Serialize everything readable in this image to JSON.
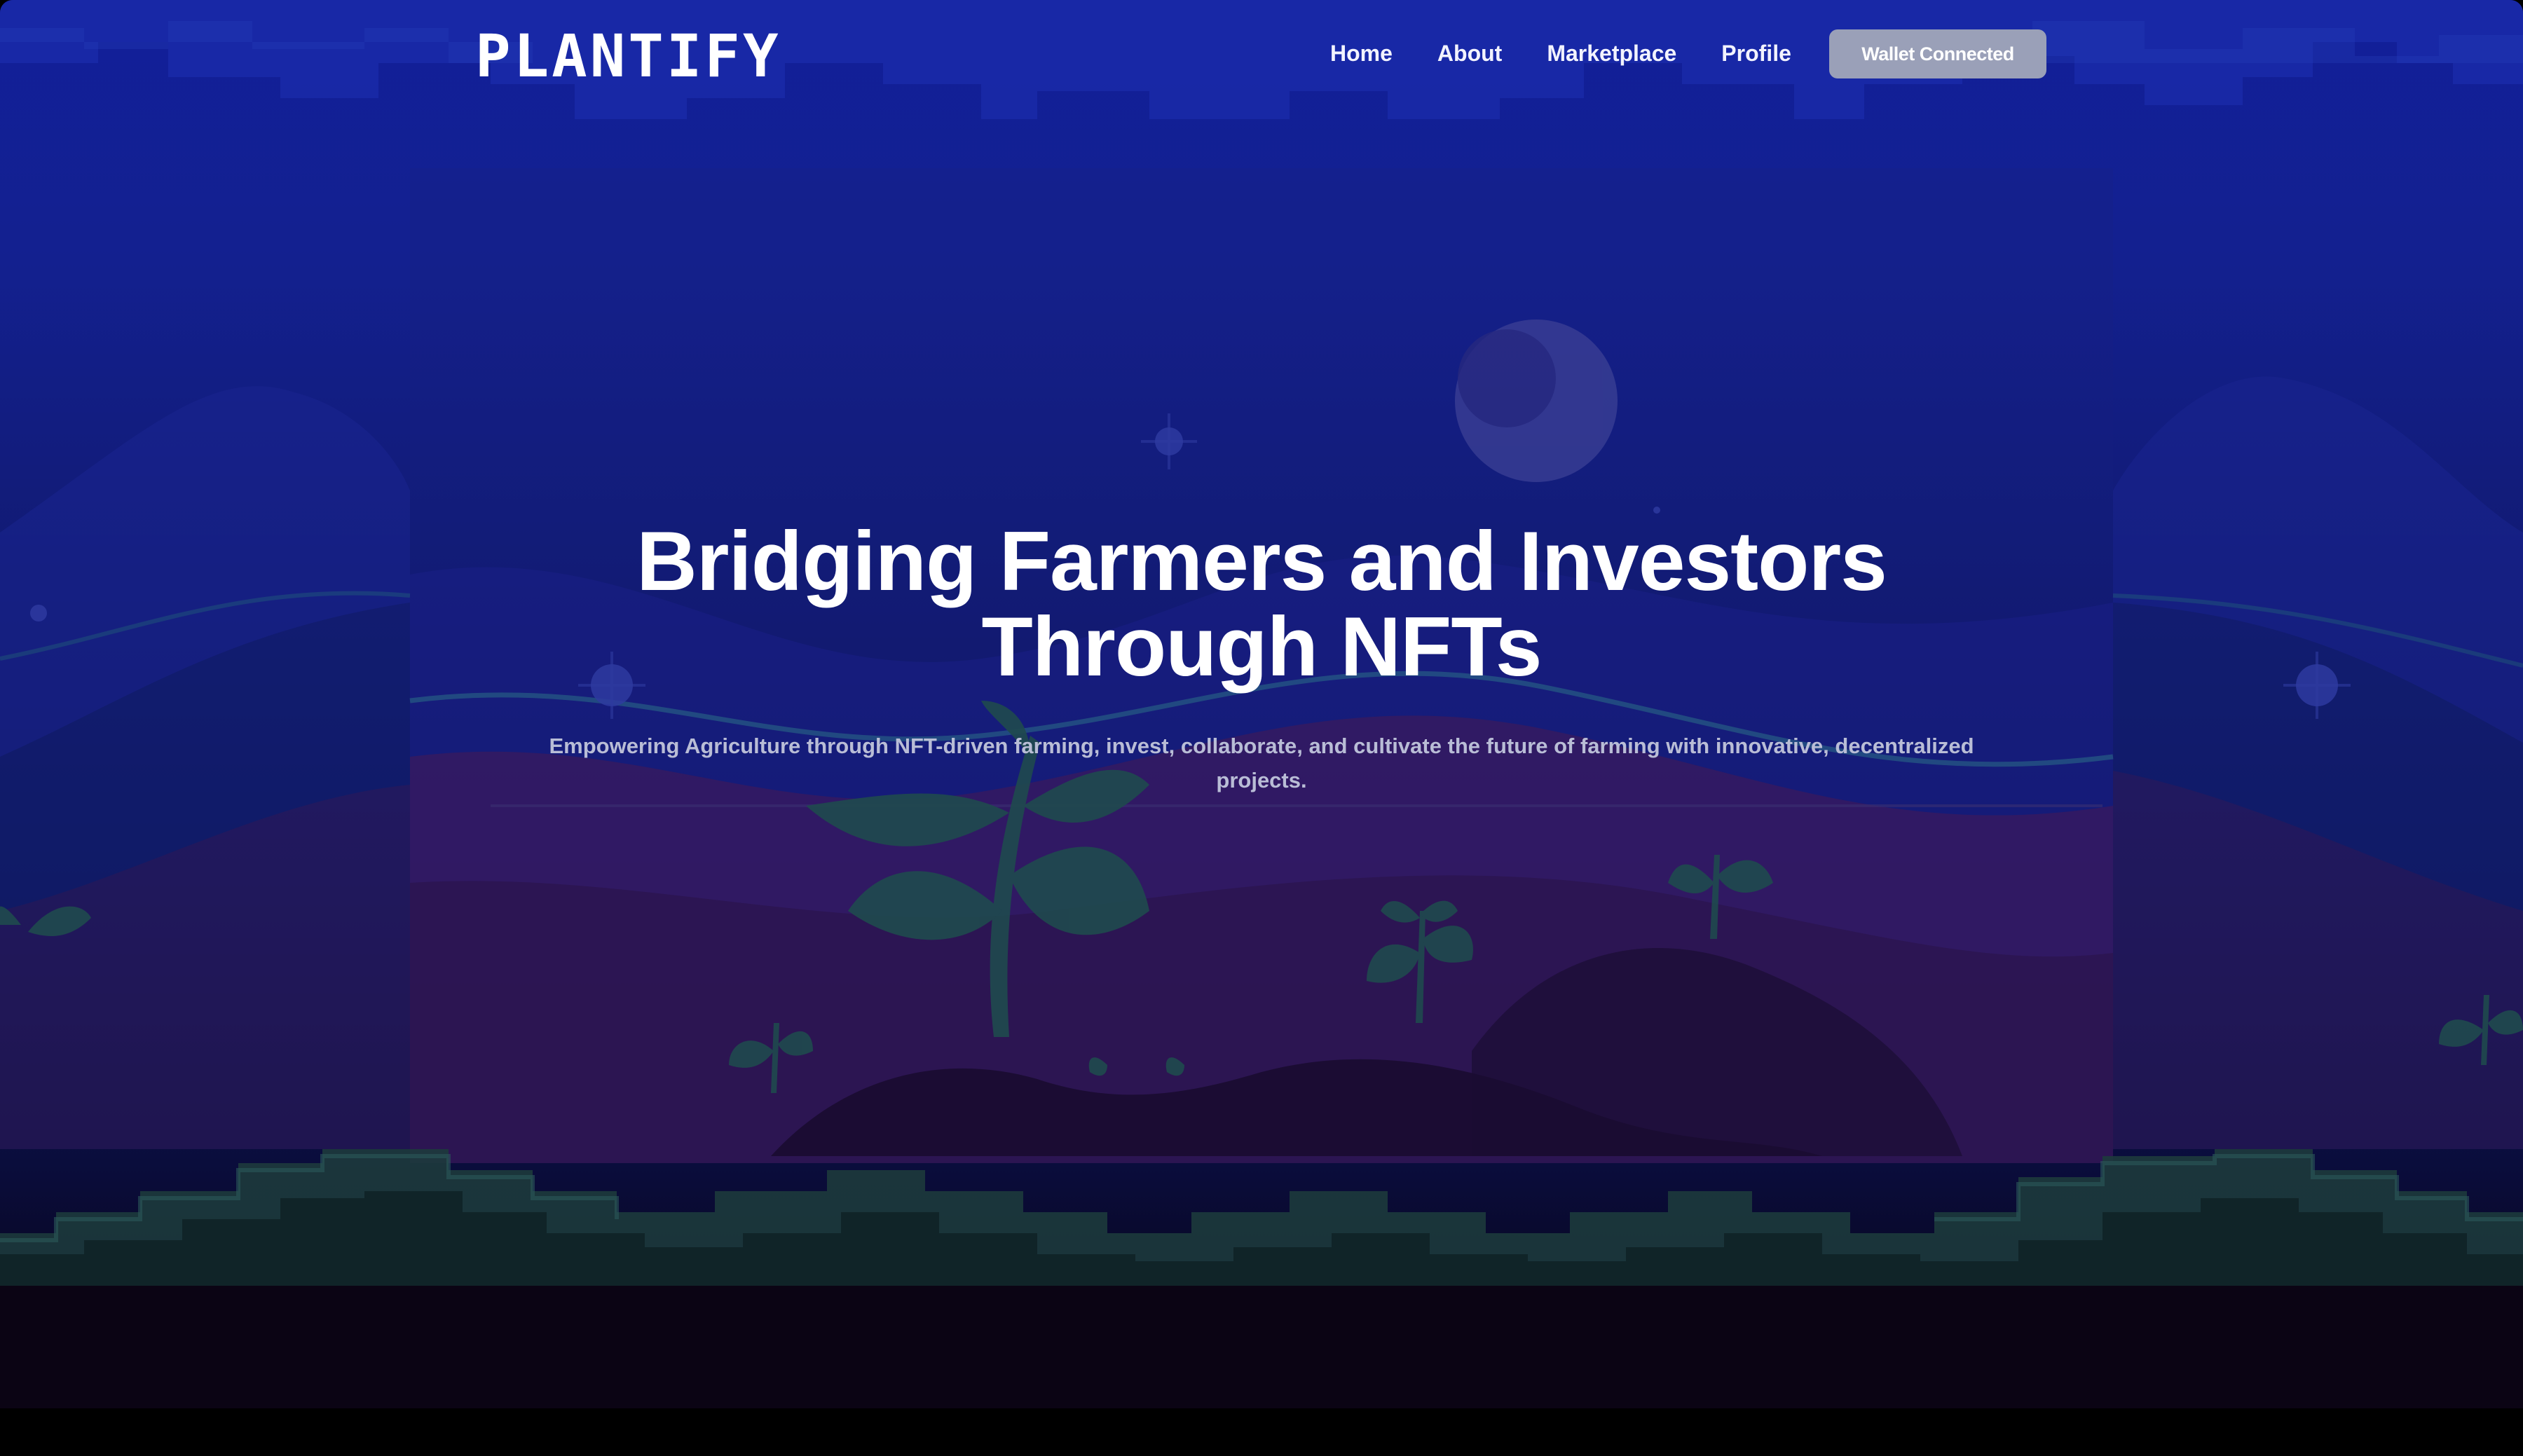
{
  "brand": {
    "logo_text": "PLANTIFY"
  },
  "nav": {
    "items": [
      {
        "label": "Home"
      },
      {
        "label": "About"
      },
      {
        "label": "Marketplace"
      },
      {
        "label": "Profile"
      }
    ],
    "wallet_button_label": "Wallet Connected"
  },
  "hero": {
    "title_line1": "Bridging Farmers and Investors",
    "title_line2": "Through NFTs",
    "subtitle": "Empowering Agriculture through NFT-driven farming, invest, collaborate, and cultivate the future of farming with innovative, decentralized projects."
  },
  "colors": {
    "background_top": "#121f9a",
    "background_bottom": "#08061f",
    "wallet_button_bg": "#9aa0b8",
    "text_primary": "#ffffff",
    "text_secondary": "#b9bdd6",
    "plant_green": "#1f4a4e",
    "moon": "#3a3e94"
  },
  "icons": [
    "moon-icon",
    "star-icon",
    "plant-icon"
  ]
}
